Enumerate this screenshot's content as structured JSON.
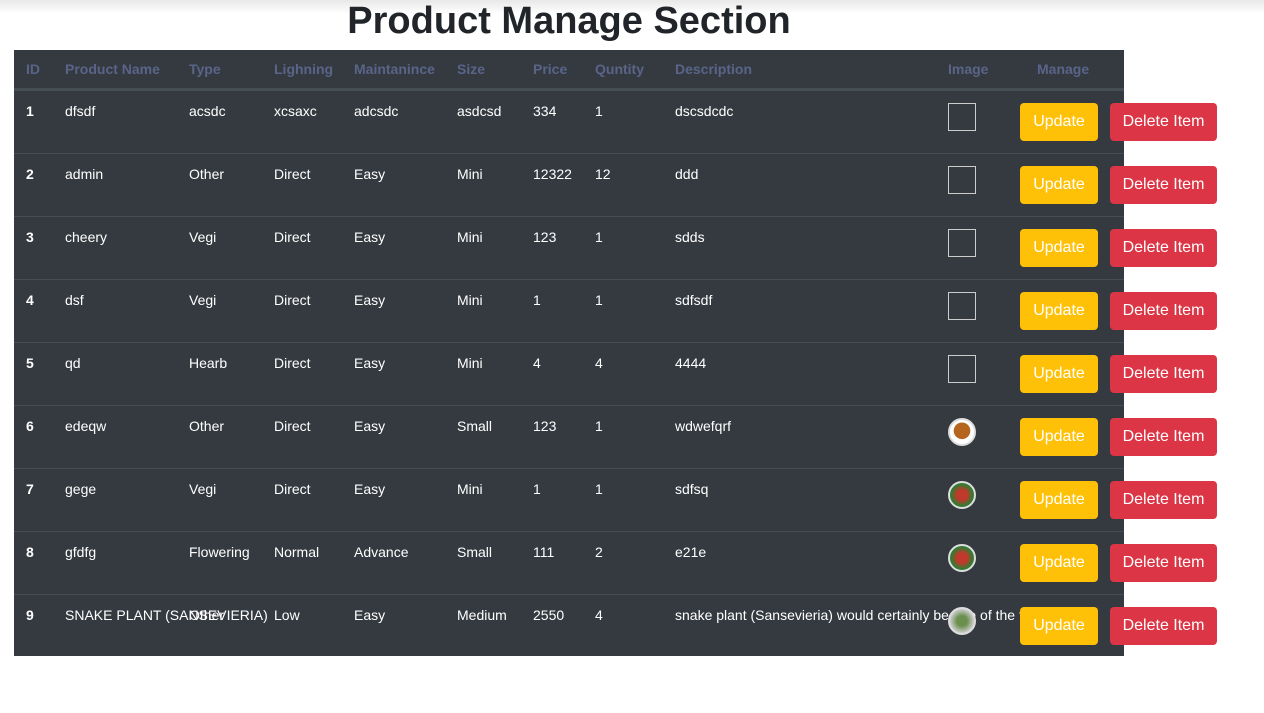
{
  "title": "Product Manage Section",
  "columns": [
    "ID",
    "Product Name",
    "Type",
    "Lighning",
    "Maintanince",
    "Size",
    "Price",
    "Quntity",
    "Description",
    "Image",
    "Manage"
  ],
  "update_label": "Update",
  "delete_label": "Delete Item",
  "colors": {
    "update": "#ffc107",
    "delete": "#dc3545",
    "table_bg": "#343a40"
  },
  "rows": [
    {
      "id": "1",
      "name": "dfsdf",
      "type": "acsdc",
      "light": "xcsaxc",
      "maint": "adcsdc",
      "size": "asdcsd",
      "price": "334",
      "qty": "1",
      "desc": "dscsdcdc",
      "image": "broken"
    },
    {
      "id": "2",
      "name": "admin",
      "type": "Other",
      "light": "Direct",
      "maint": "Easy",
      "size": "Mini",
      "price": "12322",
      "qty": "12",
      "desc": "ddd",
      "image": "broken"
    },
    {
      "id": "3",
      "name": "cheery",
      "type": "Vegi",
      "light": "Direct",
      "maint": "Easy",
      "size": "Mini",
      "price": "123",
      "qty": "1",
      "desc": "sdds",
      "image": "broken"
    },
    {
      "id": "4",
      "name": "dsf",
      "type": "Vegi",
      "light": "Direct",
      "maint": "Easy",
      "size": "Mini",
      "price": "1",
      "qty": "1",
      "desc": "sdfsdf",
      "image": "broken"
    },
    {
      "id": "5",
      "name": "qd",
      "type": "Hearb",
      "light": "Direct",
      "maint": "Easy",
      "size": "Mini",
      "price": "4",
      "qty": "4",
      "desc": "4444",
      "image": "broken"
    },
    {
      "id": "6",
      "name": "edeqw",
      "type": "Other",
      "light": "Direct",
      "maint": "Easy",
      "size": "Small",
      "price": "123",
      "qty": "1",
      "desc": "wdwefqrf",
      "image": "avatar"
    },
    {
      "id": "7",
      "name": "gege",
      "type": "Vegi",
      "light": "Direct",
      "maint": "Easy",
      "size": "Mini",
      "price": "1",
      "qty": "1",
      "desc": "sdfsq",
      "image": "red-plant"
    },
    {
      "id": "8",
      "name": "gfdfg",
      "type": "Flowering",
      "light": "Normal",
      "maint": "Advance",
      "size": "Small",
      "price": "111",
      "qty": "2",
      "desc": "e21e",
      "image": "red-plant"
    },
    {
      "id": "9",
      "name": "SNAKE PLANT (SANSEVIERIA)",
      "type": "Other",
      "light": "Low",
      "maint": "Easy",
      "size": "Medium",
      "price": "2550",
      "qty": "4",
      "desc": "snake plant (Sansevieria) would certainly be one of the first ... Sn",
      "image": "snake-plant"
    }
  ]
}
